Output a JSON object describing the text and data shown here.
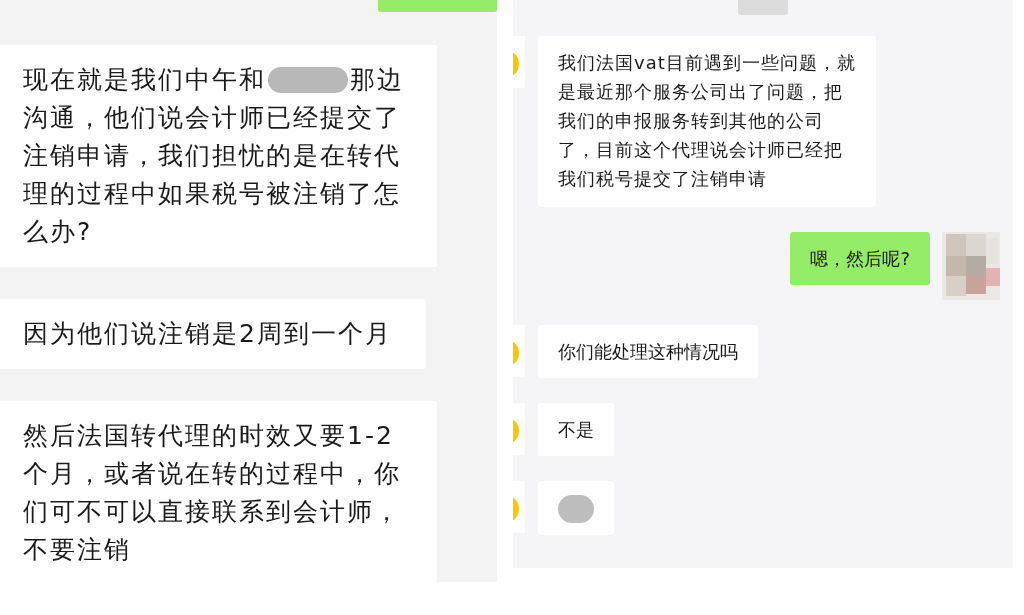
{
  "left_panel": {
    "top_bubble": {
      "outgoing": true
    },
    "messages": [
      {
        "outgoing": false,
        "kind": "redacted_inline",
        "text_before": "现在就是我们中午和",
        "text_after_redaction": "那边",
        "text_rest": "沟通，他们说会计师已经提交了注销申请，我们担忧的是在转代理的过程中如果税号被注销了怎么办?"
      },
      {
        "outgoing": false,
        "kind": "text",
        "text": "因为他们说注销是2周到一个月"
      },
      {
        "outgoing": false,
        "kind": "text",
        "text": "然后法国转代理的时效又要1-2个月，或者说在转的过程中，你们可不可以直接联系到会计师，不要注销"
      }
    ]
  },
  "right_panel": {
    "messages": [
      {
        "outgoing": false,
        "kind": "text",
        "text": "我们法国vat目前遇到一些问题，就是最近那个服务公司出了问题，把我们的申报服务转到其他的公司了，目前这个代理说会计师已经把我们税号提交了注销申请"
      },
      {
        "outgoing": true,
        "kind": "text",
        "text": "嗯，然后呢?"
      },
      {
        "outgoing": false,
        "kind": "text",
        "text": "你们能处理这种情况吗"
      },
      {
        "outgoing": false,
        "kind": "text",
        "text": "不是"
      },
      {
        "outgoing": false,
        "kind": "redacted"
      }
    ]
  }
}
